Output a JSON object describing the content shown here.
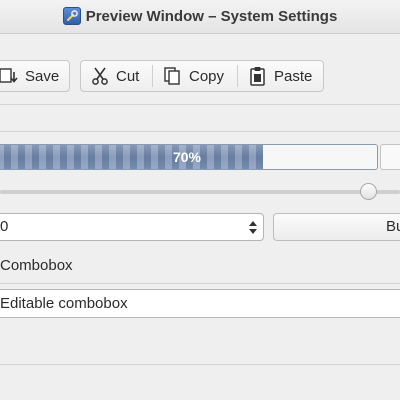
{
  "window": {
    "title": "Preview Window – System Settings",
    "icon": "tools-icon"
  },
  "toolbar": {
    "save_label": "Save",
    "cut_label": "Cut",
    "copy_label": "Copy",
    "paste_label": "Paste"
  },
  "progress": {
    "value_percent": 70,
    "label": "70%"
  },
  "slider": {
    "value_fraction": 0.92
  },
  "spinbox": {
    "value": "0"
  },
  "button": {
    "label": "Bu"
  },
  "combobox": {
    "label": "Combobox"
  },
  "editable_combobox": {
    "value": "Editable combobox"
  },
  "colors": {
    "progress_fill": "#7a90b4",
    "background": "#efefef"
  }
}
